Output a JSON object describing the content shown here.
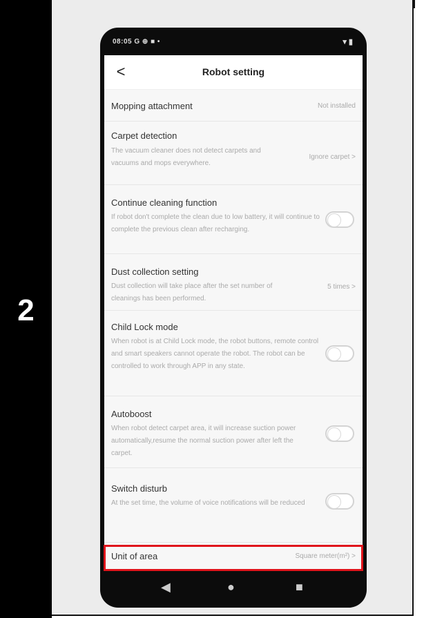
{
  "step": {
    "number": "2"
  },
  "status_bar": {
    "time": "08:05 G ⊕ ■ •",
    "right": "▾ ▮"
  },
  "header": {
    "title": "Robot setting",
    "back": "<"
  },
  "settings": {
    "mopping": {
      "title": "Mopping attachment",
      "value": "Not installed"
    },
    "carpet": {
      "title": "Carpet detection",
      "desc": "The vacuum cleaner does not detect carpets and vacuums and mops everywhere.",
      "value": "Ignore carpet >"
    },
    "continue": {
      "title": "Continue cleaning function",
      "desc": "If robot don't complete the clean due to low battery, it will continue to complete the previous clean after recharging."
    },
    "dust": {
      "title": "Dust collection setting",
      "desc": "Dust collection will take place after the set number of cleanings has been performed.",
      "value": "5 times >"
    },
    "childlock": {
      "title": "Child Lock mode",
      "desc": "When robot is at Child Lock mode, the robot buttons, remote control and smart speakers cannot operate the robot. The robot can be controlled to work through APP in any state."
    },
    "autoboost": {
      "title": "Autoboost",
      "desc": "When robot detect carpet area, it will increase suction power automatically,resume the normal suction power after left the carpet."
    },
    "disturb": {
      "title": "Switch disturb",
      "desc": "At the set time, the volume of voice notifications will be reduced"
    },
    "unit": {
      "title": "Unit of area",
      "value": "Square meter(m²) >"
    }
  },
  "system_nav": {
    "back": "◀",
    "home": "●",
    "recents": "■"
  },
  "colors": {
    "highlight": "#e0141b",
    "toggle_off": "#d3d3d3"
  }
}
